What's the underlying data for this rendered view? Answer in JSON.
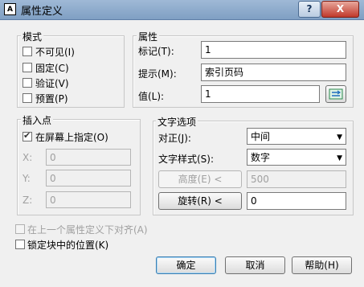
{
  "window": {
    "title": "属性定义",
    "app_icon": "A",
    "help_label": "?",
    "close_label": "X"
  },
  "mode": {
    "title": "模式",
    "options": [
      {
        "label": "不可见(I)",
        "checked": false
      },
      {
        "label": "固定(C)",
        "checked": false
      },
      {
        "label": "验证(V)",
        "checked": false
      },
      {
        "label": "预置(P)",
        "checked": false
      }
    ]
  },
  "attribute": {
    "title": "属性",
    "tag_label": "标记(T):",
    "tag_value": "1",
    "prompt_label": "提示(M):",
    "prompt_value": "索引页码",
    "default_label": "值(L):",
    "default_value": "1",
    "field_button_icon": "insert-field-icon"
  },
  "insertion": {
    "title": "插入点",
    "specify_label": "在屏幕上指定(O)",
    "specify_checked": true,
    "x_label": "X:",
    "x_value": "0",
    "y_label": "Y:",
    "y_value": "0",
    "z_label": "Z:",
    "z_value": "0"
  },
  "text_options": {
    "title": "文字选项",
    "justify_label": "对正(J):",
    "justify_value": "中间",
    "style_label": "文字样式(S):",
    "style_value": "数字",
    "height_button": "高度(E) <",
    "height_value": "500",
    "rotation_button": "旋转(R) <",
    "rotation_value": "0"
  },
  "bottom": {
    "align_below_label": "在上一个属性定义下对齐(A)",
    "lock_position_label": "锁定块中的位置(K)"
  },
  "buttons": {
    "ok": "确定",
    "cancel": "取消",
    "help": "帮助(H)"
  }
}
